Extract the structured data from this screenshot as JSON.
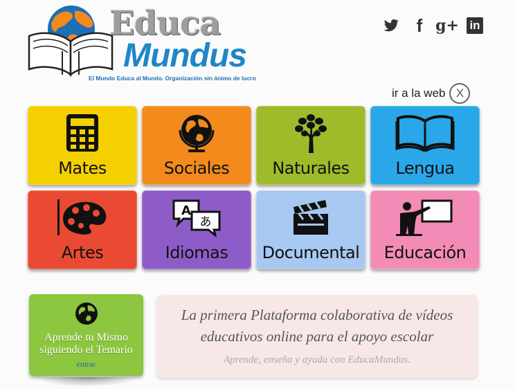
{
  "logo": {
    "word1": "Educa",
    "word2": "Mundus",
    "tagline": "El Mundo Educa al Mundo. Organización sin ánimo de lucro"
  },
  "social": [
    {
      "name": "twitter-icon"
    },
    {
      "name": "facebook-icon",
      "glyph": "f"
    },
    {
      "name": "google-plus-icon",
      "glyph": "g+"
    },
    {
      "name": "linkedin-icon",
      "glyph": "in"
    }
  ],
  "goweb": {
    "label": "ir a la web",
    "close": "X"
  },
  "tiles": [
    {
      "label": "Mates",
      "color": "#f5d000",
      "icon": "calculator-icon"
    },
    {
      "label": "Sociales",
      "color": "#f28a1c",
      "icon": "globe-icon"
    },
    {
      "label": "Naturales",
      "color": "#9ebc2a",
      "icon": "tree-icon"
    },
    {
      "label": "Lengua",
      "color": "#2aa7e8",
      "icon": "open-book-icon"
    },
    {
      "label": "Artes",
      "color": "#ea4a33",
      "icon": "palette-icon"
    },
    {
      "label": "Idiomas",
      "color": "#8e5cc8",
      "icon": "translate-icon"
    },
    {
      "label": "Documental",
      "color": "#a7c8f0",
      "icon": "clapperboard-icon"
    },
    {
      "label": "Educación",
      "color": "#f28cb6",
      "icon": "teacher-icon"
    }
  ],
  "learn_card": {
    "title_line1": "Aprende tu Mismo",
    "title_line2": "siguiendo el Temario",
    "link": "entrar",
    "color": "#8dc63f"
  },
  "promo": {
    "headline_line1": "La primera Plataforma colaborativa de vídeos",
    "headline_line2": "educativos online para el apoyo escolar",
    "subline": "Aprende, enseña y ayuda con EducaMundus."
  }
}
